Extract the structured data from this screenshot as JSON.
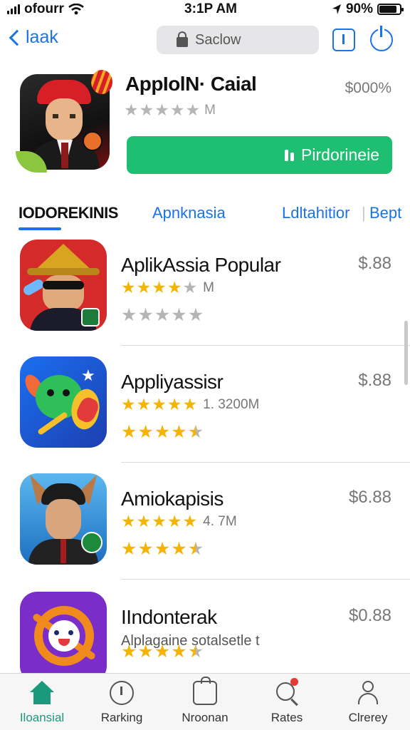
{
  "status_bar": {
    "carrier": "ofourr",
    "time": "3:1P AM",
    "battery_text": "90%"
  },
  "nav": {
    "back_label": "laak",
    "search_text": "Saclow"
  },
  "featured": {
    "title": "AppIolN· Caial",
    "price": "$000%",
    "rating_stars": 0,
    "rating_count": "M",
    "button_label": "Pirdorineie"
  },
  "tabs": [
    {
      "label": "IODOREKINIS",
      "active": true
    },
    {
      "label": "Apnknasia",
      "active": false
    },
    {
      "label": "Ldltahitior",
      "active": false
    },
    {
      "label": "Bept",
      "active": false
    }
  ],
  "apps": [
    {
      "name": "AplikAssia Popular",
      "price": "$.88",
      "stars": 4,
      "count": "M",
      "subtitle": "",
      "stars2": 0
    },
    {
      "name": "Appliyassisr",
      "price": "$.88",
      "stars": 5,
      "count": "1. 3200M",
      "subtitle": "",
      "stars2": 4.5
    },
    {
      "name": "Amiokapisis",
      "price": "$6.88",
      "stars": 5,
      "count": "4. 7M",
      "subtitle": "",
      "stars2": 4.5
    },
    {
      "name": "IIndonterak",
      "price": "$0.88",
      "stars": 0,
      "count": "",
      "subtitle": "Alplagaine sotalsetle t",
      "stars2": 4.5
    }
  ],
  "tabbar": [
    {
      "label": "Iloansial",
      "icon": "home-icon",
      "active": true
    },
    {
      "label": "Rarking",
      "icon": "clock-icon",
      "active": false
    },
    {
      "label": "Nroonan",
      "icon": "bag-icon",
      "active": false
    },
    {
      "label": "Rates",
      "icon": "search-icon",
      "active": false
    },
    {
      "label": "Clrerey",
      "icon": "person-icon",
      "active": false
    }
  ],
  "colors": {
    "accent": "#1a73e8",
    "button_green": "#1fbf72",
    "star_gold": "#f4b400",
    "tab_active": "#1a9a7a"
  }
}
